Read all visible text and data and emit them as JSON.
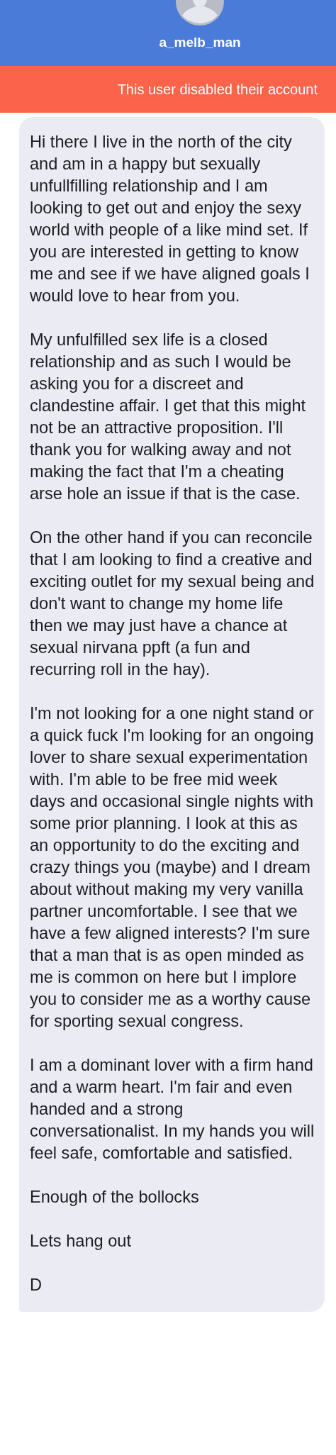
{
  "header": {
    "username": "a_melb_man"
  },
  "banner": {
    "text": "This user disabled their account"
  },
  "message": {
    "paragraphs": [
      "Hi there I live in the north of the city and am in a happy but sexually unfullfilling relationship and I am looking to get out and enjoy the sexy world with people of a like mind set. If you are interested in getting to know me and see if we have aligned goals I would love to hear from you.",
      "My unfulfilled sex life is a closed relationship and as such I would be asking you for a discreet and clandestine affair. I get that this might not be an attractive proposition. I'll thank you for walking away and not making the fact that I'm a cheating arse hole an issue if that is the case.",
      "On the other hand if you can reconcile that I am looking to find a creative and exciting outlet for my sexual being and don't want to change my home life then we may just have a chance at sexual nirvana ppft (a fun and recurring roll in the hay).",
      "I'm not looking for a one night stand or a quick fuck I'm looking for an ongoing lover to share sexual experimentation with. I'm able to be free mid week days and occasional single nights with some prior planning. I look at this as an opportunity to do the exciting and crazy things you (maybe) and I dream about without making my very vanilla partner uncomfortable. I see that we have a few aligned interests? I'm sure that a man that is as open minded as me is common on here but I implore you to consider me as a worthy cause for sporting sexual congress.",
      "I am a dominant lover with a firm hand and a warm heart. I'm fair and even handed and a strong conversationalist. In my hands you will feel safe, comfortable and satisfied.",
      "Enough of the bollocks",
      "Lets hang out",
      "D"
    ]
  }
}
